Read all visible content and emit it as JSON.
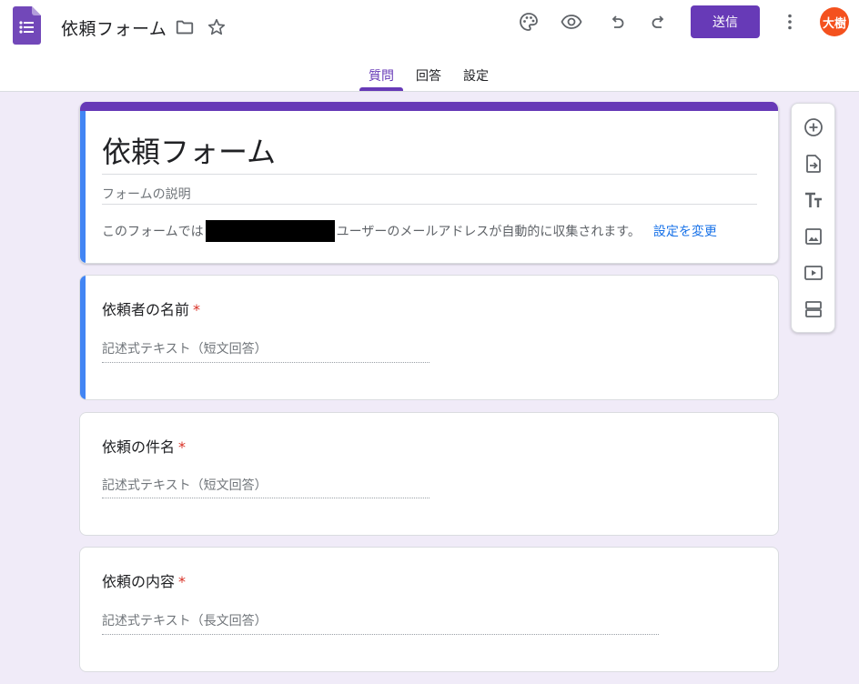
{
  "header": {
    "doc_title": "依頼フォーム",
    "send_label": "送信",
    "avatar_text": "大樹",
    "tabs": [
      {
        "label": "質問",
        "active": true
      },
      {
        "label": "回答",
        "active": false
      },
      {
        "label": "設定",
        "active": false
      }
    ]
  },
  "form": {
    "title": "依頼フォーム",
    "description_placeholder": "フォームの説明",
    "email_note_prefix": "このフォームでは",
    "email_note_suffix": "ユーザーのメールアドレスが自動的に収集されます。",
    "settings_link": "設定を変更"
  },
  "questions": [
    {
      "title": "依頼者の名前",
      "required_mark": "*",
      "placeholder": "記述式テキスト（短文回答）"
    },
    {
      "title": "依頼の件名",
      "required_mark": "*",
      "placeholder": "記述式テキスト（短文回答）"
    },
    {
      "title": "依頼の内容",
      "required_mark": "*",
      "placeholder": "記述式テキスト（長文回答）"
    }
  ],
  "icons": {
    "app": "google-forms-icon",
    "folder": "folder-icon",
    "star": "star-icon",
    "palette": "palette-icon",
    "preview": "eye-icon",
    "undo": "undo-icon",
    "redo": "redo-icon",
    "more": "more-vert-icon",
    "sidebar": [
      "add-circle-icon",
      "import-icon",
      "title-icon",
      "image-icon",
      "video-icon",
      "section-icon"
    ]
  },
  "colors": {
    "accent": "#673ab7",
    "focus": "#4285f4",
    "background": "#f0ebf8",
    "required": "#d93025",
    "link": "#1a73e8",
    "avatar": "#f4511e"
  }
}
